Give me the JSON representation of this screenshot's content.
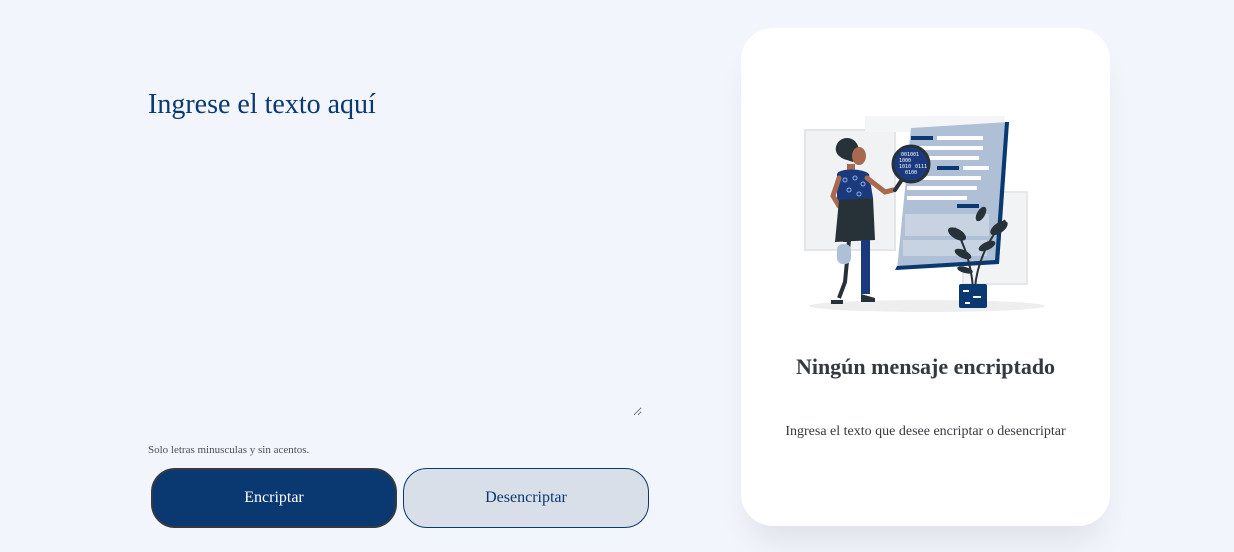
{
  "input": {
    "placeholder": "Ingrese el texto aquí",
    "value": ""
  },
  "hint": {
    "text": "Solo letras minusculas y sin acentos."
  },
  "buttons": {
    "encrypt_label": "Encriptar",
    "decrypt_label": "Desencriptar"
  },
  "result": {
    "title": "Ningún mensaje encriptado",
    "description": "Ingresa el texto que desee encriptar o desencriptar",
    "illustration": "person-inspecting-document-with-magnifier",
    "illustration_text": [
      "001001",
      "1000",
      "1010",
      "0111",
      "0100"
    ]
  },
  "colors": {
    "background": "#f3f5fc",
    "primary": "#0a3871",
    "secondary_button": "#d8dfe8",
    "text_dark": "#343a40",
    "card": "#ffffff"
  }
}
